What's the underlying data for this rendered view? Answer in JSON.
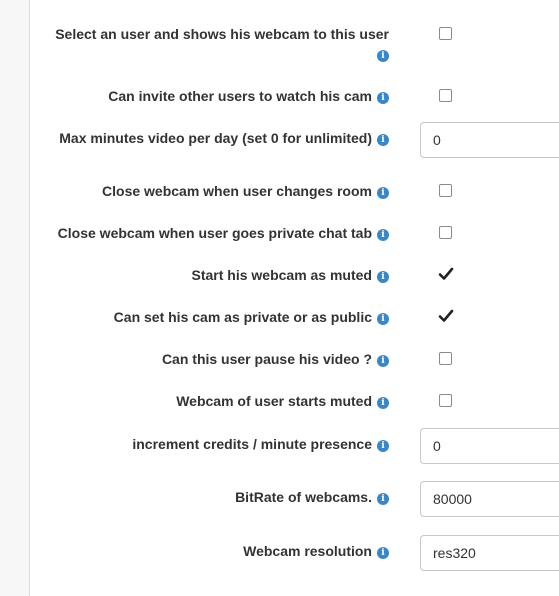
{
  "settings": [
    {
      "label": "Select an user and shows his webcam to this user",
      "control": "checkbox",
      "checked": false
    },
    {
      "label": "Can invite other users to watch his cam",
      "control": "checkbox",
      "checked": false
    },
    {
      "label": "Max minutes video per day (set 0 for unlimited)",
      "control": "input",
      "value": "0"
    },
    {
      "label": "Close webcam when user changes room",
      "control": "checkbox",
      "checked": false
    },
    {
      "label": "Close webcam when user goes private chat tab",
      "control": "checkbox",
      "checked": false
    },
    {
      "label": "Start his webcam as muted",
      "control": "checkbox",
      "checked": true
    },
    {
      "label": "Can set his cam as private or as public",
      "control": "checkbox",
      "checked": true
    },
    {
      "label": "Can this user pause his video ?",
      "control": "checkbox",
      "checked": false
    },
    {
      "label": "Webcam of user starts muted",
      "control": "checkbox",
      "checked": false
    },
    {
      "label": "increment credits / minute presence",
      "control": "input",
      "value": "0"
    },
    {
      "label": "BitRate of webcams.",
      "control": "input",
      "value": "80000"
    },
    {
      "label": "Webcam resolution",
      "control": "input",
      "value": "res320"
    }
  ],
  "icons": {
    "info": "info-icon",
    "check": "check-icon"
  },
  "colors": {
    "info_icon": "#3a87c7",
    "label_text": "#333333",
    "checkmark": "#222222"
  }
}
